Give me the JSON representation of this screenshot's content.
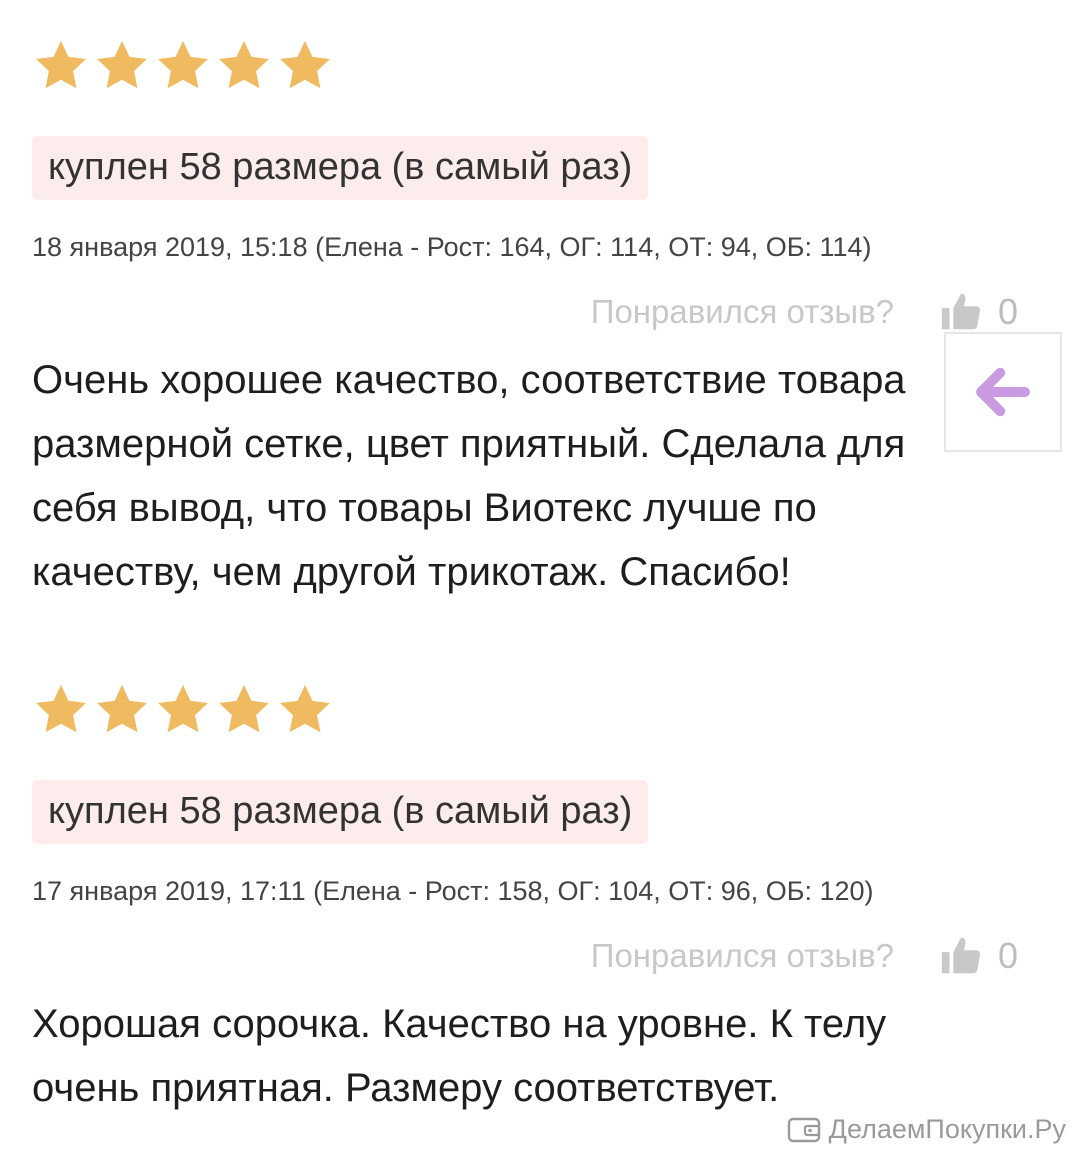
{
  "colors": {
    "star": "#f0bb60",
    "badge_bg": "#fdecec",
    "arrow": "#c99ae0",
    "muted": "#c8c8c8"
  },
  "reviews": [
    {
      "rating": 5,
      "size_badge": "куплен 58 размера (в самый раз)",
      "meta": "18 января 2019, 15:18 (Елена - Рост: 164, ОГ: 114, ОТ: 94, ОБ: 114)",
      "like_question": "Понравился отзыв?",
      "like_count": "0",
      "text": "Очень хорошее качество, соответствие товара размерной сетке, цвет приятный. Сделала для себя вывод, что товары Виотекс лучше по качеству, чем другой трикотаж. Спасибо!"
    },
    {
      "rating": 5,
      "size_badge": "куплен 58 размера (в самый раз)",
      "meta": "17 января 2019, 17:11 (Елена - Рост: 158, ОГ: 104, ОТ: 96, ОБ: 120)",
      "like_question": "Понравился отзыв?",
      "like_count": "0",
      "text": "Хорошая сорочка. Качество на уровне. К телу очень приятная. Размеру соответствует."
    }
  ],
  "back_button": {
    "icon": "arrow-left-icon"
  },
  "watermark": {
    "text": "ДелаемПокупки.Ру",
    "icon": "wallet-logo-icon"
  }
}
